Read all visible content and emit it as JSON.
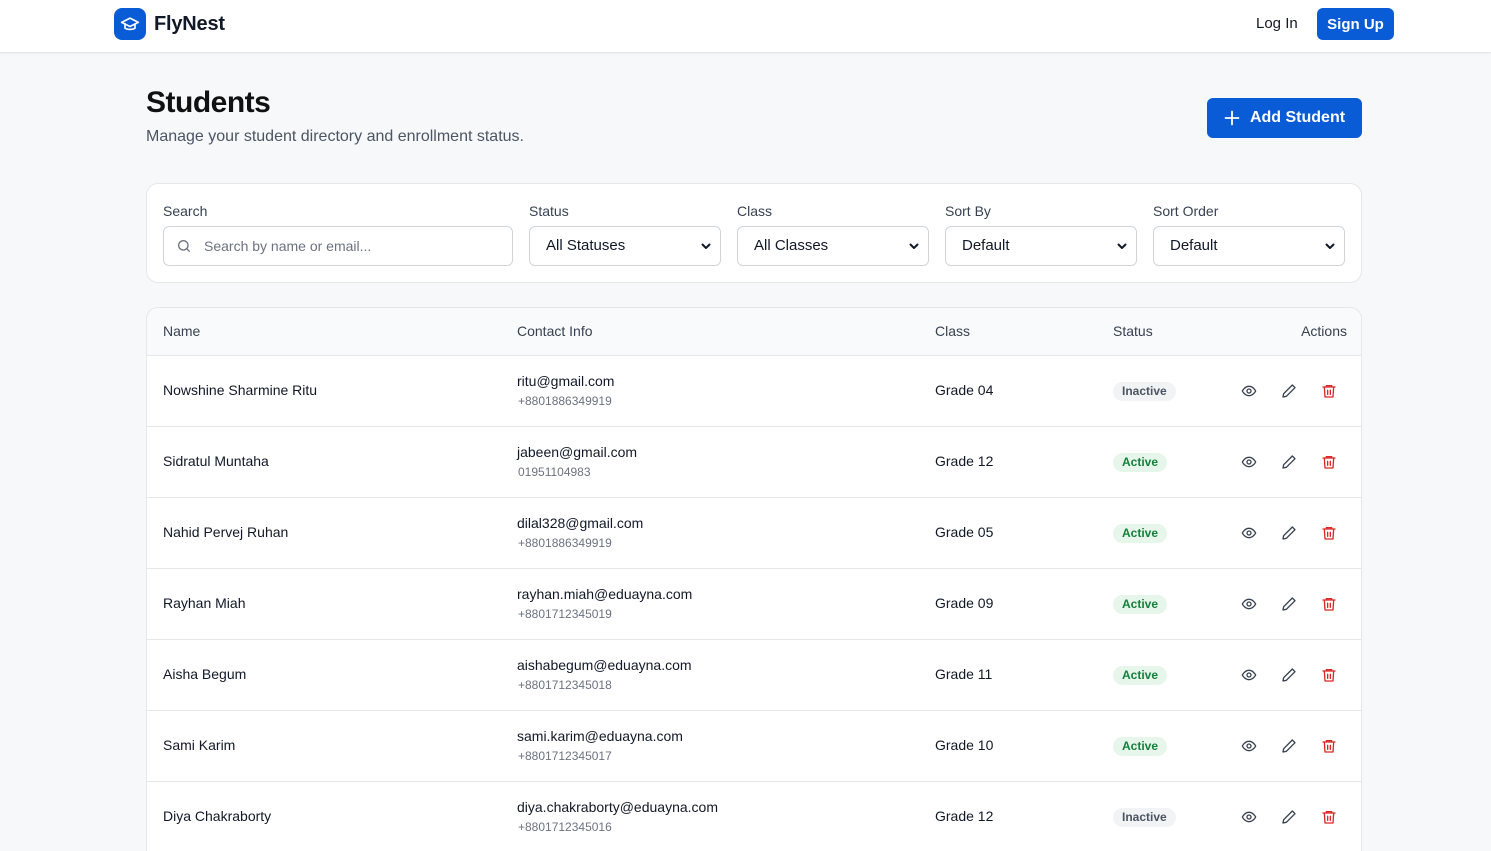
{
  "app": {
    "name": "FlyNest",
    "login_label": "Log In",
    "signup_label": "Sign Up",
    "brand_color": "#0a5bd6"
  },
  "header": {
    "title": "Students",
    "subtitle": "Manage your student directory and enrollment status.",
    "add_label": "Add Student"
  },
  "filters": {
    "search_label": "Search",
    "search_placeholder": "Search by name or email...",
    "status_label": "Status",
    "status_value": "All Statuses",
    "class_label": "Class",
    "class_value": "All Classes",
    "sort_by_label": "Sort By",
    "sort_by_value": "Default",
    "sort_order_label": "Sort Order",
    "sort_order_value": "Default"
  },
  "table": {
    "columns": [
      "Name",
      "Contact Info",
      "Class",
      "Status",
      "Actions"
    ],
    "rows": [
      {
        "name": "Nowshine Sharmine Ritu",
        "email": "ritu@gmail.com",
        "phone": "+8801886349919",
        "class": "Grade 04",
        "status": "Inactive"
      },
      {
        "name": "Sidratul Muntaha",
        "email": "jabeen@gmail.com",
        "phone": "01951104983",
        "class": "Grade 12",
        "status": "Active"
      },
      {
        "name": "Nahid Pervej Ruhan",
        "email": "dilal328@gmail.com",
        "phone": "+8801886349919",
        "class": "Grade 05",
        "status": "Active"
      },
      {
        "name": "Rayhan Miah",
        "email": "rayhan.miah@eduayna.com",
        "phone": "+8801712345019",
        "class": "Grade 09",
        "status": "Active"
      },
      {
        "name": "Aisha Begum",
        "email": "aishabegum@eduayna.com",
        "phone": "+8801712345018",
        "class": "Grade 11",
        "status": "Active"
      },
      {
        "name": "Sami Karim",
        "email": "sami.karim@eduayna.com",
        "phone": "+8801712345017",
        "class": "Grade 10",
        "status": "Active"
      },
      {
        "name": "Diya Chakraborty",
        "email": "diya.chakraborty@eduayna.com",
        "phone": "+8801712345016",
        "class": "Grade 12",
        "status": "Inactive"
      }
    ],
    "row_actions": [
      "eye-icon",
      "pencil-icon",
      "trash-icon"
    ]
  }
}
